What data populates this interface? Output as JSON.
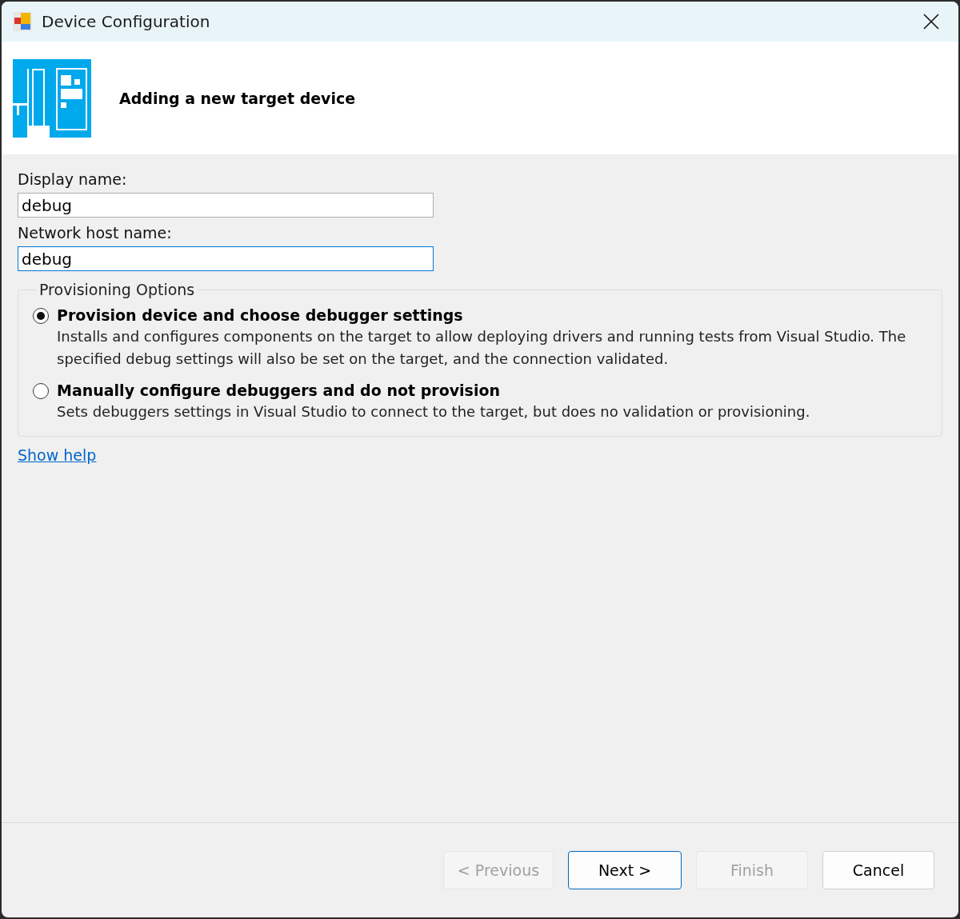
{
  "window": {
    "title": "Device Configuration"
  },
  "header": {
    "heading": "Adding a new target device"
  },
  "fields": [
    {
      "label": "Display name:",
      "value": "debug",
      "focused": false
    },
    {
      "label": "Network host name:",
      "value": "debug",
      "focused": true
    }
  ],
  "provisioning": {
    "legend": "Provisioning Options",
    "options": [
      {
        "title": "Provision device and choose debugger settings",
        "description": "Installs and configures components on the target to allow deploying drivers and running tests from Visual Studio. The specified debug settings will also be set on the target, and the connection validated.",
        "selected": true
      },
      {
        "title": "Manually configure debuggers and do not provision",
        "description": "Sets debuggers settings in Visual Studio to connect to the target, but does no validation or provisioning.",
        "selected": false
      }
    ]
  },
  "help_link": "Show help",
  "buttons": [
    {
      "label": "< Previous",
      "disabled": true,
      "default": false
    },
    {
      "label": "Next >",
      "disabled": false,
      "default": true
    },
    {
      "label": "Finish",
      "disabled": true,
      "default": false
    },
    {
      "label": "Cancel",
      "disabled": false,
      "default": false
    }
  ]
}
